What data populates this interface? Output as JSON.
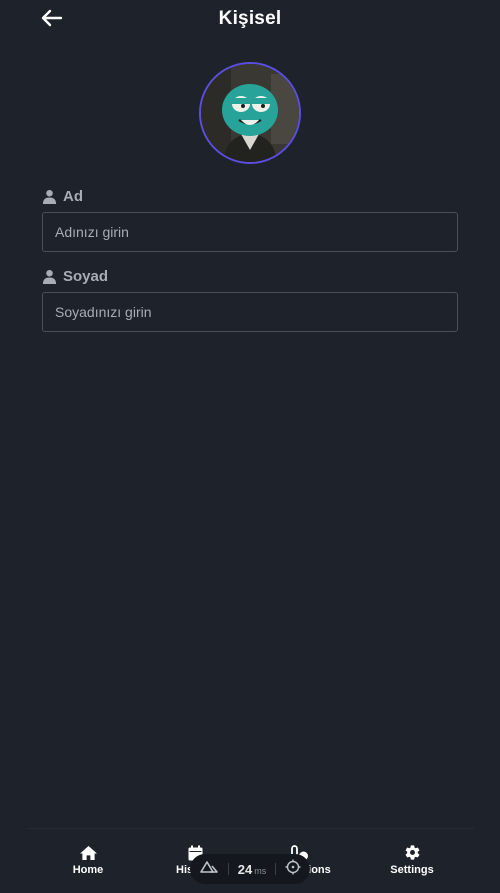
{
  "header": {
    "title": "Kişisel",
    "back_icon": "arrow-left-icon"
  },
  "profile": {
    "avatar_icon": "profile-photo",
    "accent_color": "#5a4fe0"
  },
  "form": {
    "first_name": {
      "label": "Ad",
      "placeholder": "Adınızı girin",
      "value": ""
    },
    "last_name": {
      "label": "Soyad",
      "placeholder": "Soyadınızı girin",
      "value": ""
    }
  },
  "bottom_nav": {
    "items": [
      {
        "label": "Home",
        "icon": "home-icon"
      },
      {
        "label": "History",
        "icon": "calendar-icon"
      },
      {
        "label": "Medications",
        "icon": "pill-icon"
      },
      {
        "label": "Settings",
        "icon": "gear-icon"
      }
    ]
  },
  "devtools": {
    "value": "24",
    "unit": "ms",
    "icon_left": "nuxt-logo-icon",
    "icon_right": "crosshair-icon"
  },
  "colors": {
    "background": "#1d222b",
    "input_border": "#4a4f58",
    "label": "#a7acb5"
  }
}
